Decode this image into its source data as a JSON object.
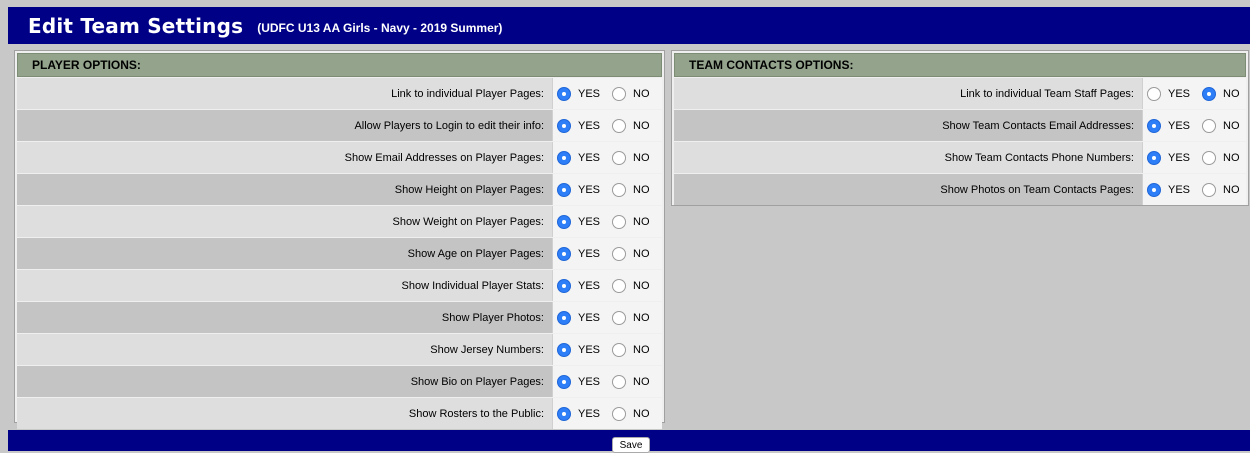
{
  "header": {
    "title": "Edit Team Settings",
    "subtitle": "(UDFC U13 AA Girls - Navy - 2019 Summer)"
  },
  "yes_label": "YES",
  "no_label": "NO",
  "player_options": {
    "heading": "PLAYER OPTIONS:",
    "rows": [
      {
        "label": "Link to individual Player Pages:",
        "value": "YES"
      },
      {
        "label": "Allow Players to Login to edit their info:",
        "value": "YES"
      },
      {
        "label": "Show Email Addresses on Player Pages:",
        "value": "YES"
      },
      {
        "label": "Show Height on Player Pages:",
        "value": "YES"
      },
      {
        "label": "Show Weight on Player Pages:",
        "value": "YES"
      },
      {
        "label": "Show Age on Player Pages:",
        "value": "YES"
      },
      {
        "label": "Show Individual Player Stats:",
        "value": "YES"
      },
      {
        "label": "Show Player Photos:",
        "value": "YES"
      },
      {
        "label": "Show Jersey Numbers:",
        "value": "YES"
      },
      {
        "label": "Show Bio on Player Pages:",
        "value": "YES"
      },
      {
        "label": "Show Rosters to the Public:",
        "value": "YES"
      }
    ]
  },
  "team_contacts_options": {
    "heading": "TEAM CONTACTS OPTIONS:",
    "rows": [
      {
        "label": "Link to individual Team Staff Pages:",
        "value": "NO"
      },
      {
        "label": "Show Team Contacts Email Addresses:",
        "value": "YES"
      },
      {
        "label": "Show Team Contacts Phone Numbers:",
        "value": "YES"
      },
      {
        "label": "Show Photos on Team Contacts Pages:",
        "value": "YES"
      }
    ]
  },
  "footer": {
    "save_label": "Save"
  },
  "colors": {
    "header_bg": "#000087",
    "section_header_bg": "#93a38c",
    "radio_selected": "#2e7ef7"
  }
}
